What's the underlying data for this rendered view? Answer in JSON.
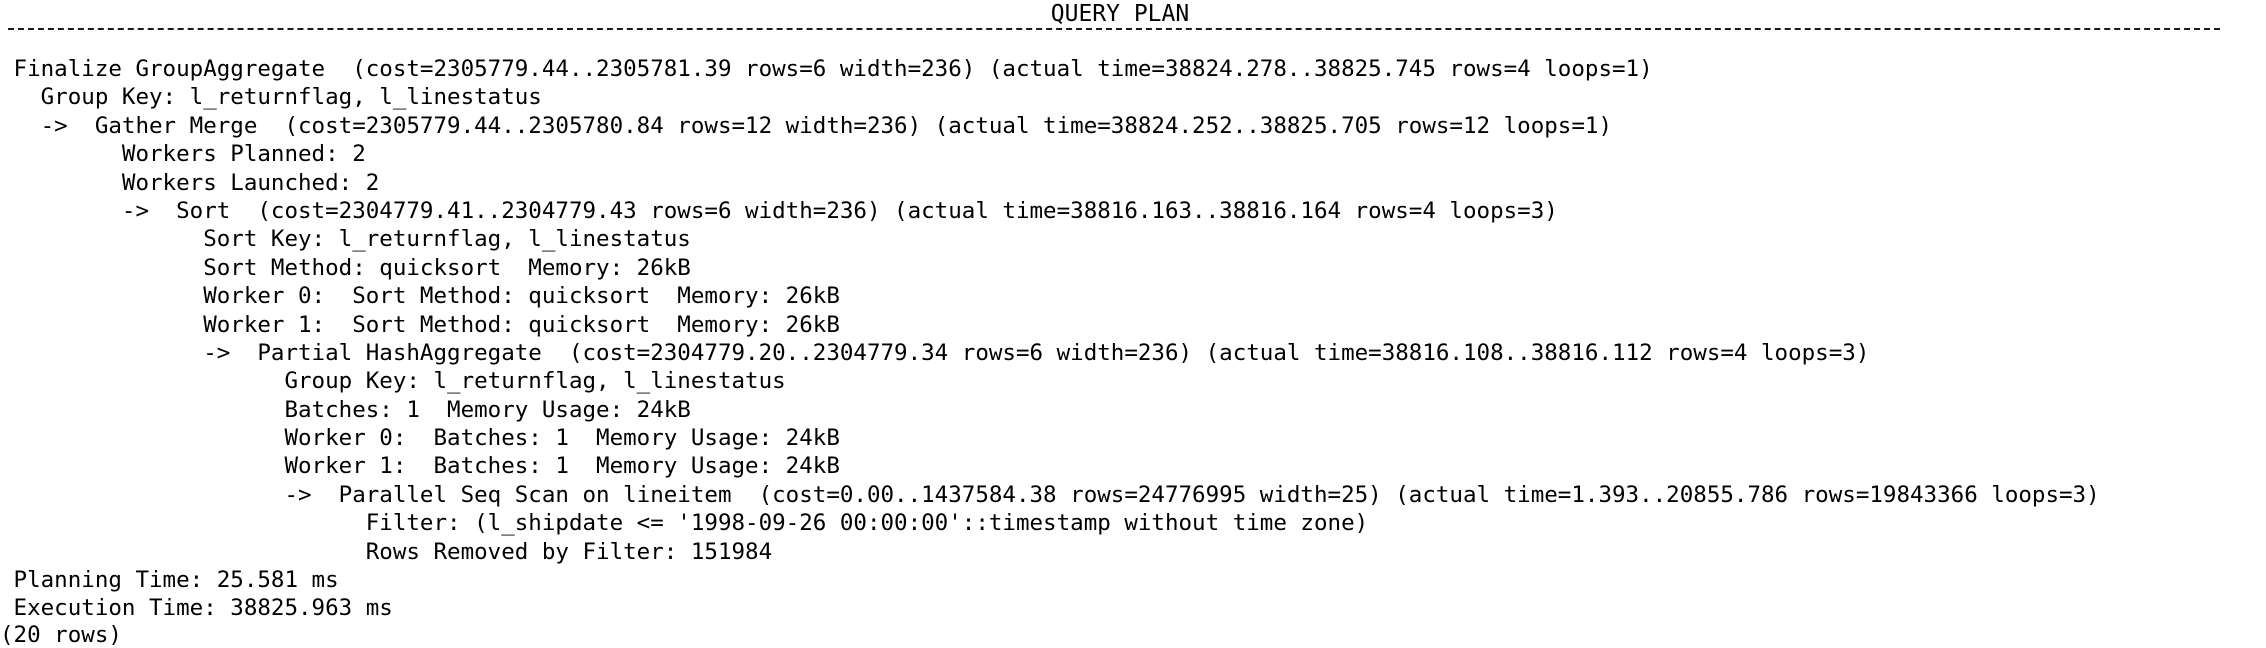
{
  "header": "QUERY PLAN",
  "lines": [
    " Finalize GroupAggregate  (cost=2305779.44..2305781.39 rows=6 width=236) (actual time=38824.278..38825.745 rows=4 loops=1)",
    "   Group Key: l_returnflag, l_linestatus",
    "   ->  Gather Merge  (cost=2305779.44..2305780.84 rows=12 width=236) (actual time=38824.252..38825.705 rows=12 loops=1)",
    "         Workers Planned: 2",
    "         Workers Launched: 2",
    "         ->  Sort  (cost=2304779.41..2304779.43 rows=6 width=236) (actual time=38816.163..38816.164 rows=4 loops=3)",
    "               Sort Key: l_returnflag, l_linestatus",
    "               Sort Method: quicksort  Memory: 26kB",
    "               Worker 0:  Sort Method: quicksort  Memory: 26kB",
    "               Worker 1:  Sort Method: quicksort  Memory: 26kB",
    "               ->  Partial HashAggregate  (cost=2304779.20..2304779.34 rows=6 width=236) (actual time=38816.108..38816.112 rows=4 loops=3)",
    "                     Group Key: l_returnflag, l_linestatus",
    "                     Batches: 1  Memory Usage: 24kB",
    "                     Worker 0:  Batches: 1  Memory Usage: 24kB",
    "                     Worker 1:  Batches: 1  Memory Usage: 24kB",
    "                     ->  Parallel Seq Scan on lineitem  (cost=0.00..1437584.38 rows=24776995 width=25) (actual time=1.393..20855.786 rows=19843366 loops=3)",
    "                           Filter: (l_shipdate <= '1998-09-26 00:00:00'::timestamp without time zone)",
    "                           Rows Removed by Filter: 151984",
    " Planning Time: 25.581 ms",
    " Execution Time: 38825.963 ms"
  ],
  "footer": "(20 rows)"
}
